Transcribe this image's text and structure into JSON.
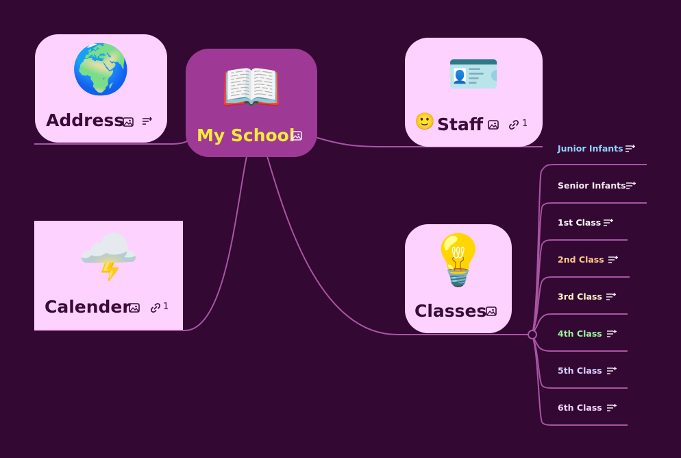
{
  "central": {
    "title": "My School",
    "emoji": "📖"
  },
  "nodes": {
    "address": {
      "title": "Address",
      "emoji": "🌍"
    },
    "staff": {
      "title": "Staff",
      "emoji": "🪪",
      "prefix_emoji": "🙂",
      "link_count": "1"
    },
    "calender": {
      "title": "Calender",
      "emoji": "🌩️",
      "link_count": "1"
    },
    "classes": {
      "title": "Classes",
      "emoji": "💡"
    }
  },
  "class_list": [
    {
      "label": "Junior Infants",
      "color": "#8fd6ff"
    },
    {
      "label": "Senior Infants",
      "color": "#f4e6f4"
    },
    {
      "label": "1st Class",
      "color": "#ffffff"
    },
    {
      "label": "2nd Class",
      "color": "#ffc98a"
    },
    {
      "label": "3rd Class",
      "color": "#fff3c4"
    },
    {
      "label": "4th Class",
      "color": "#9af59a"
    },
    {
      "label": "5th Class",
      "color": "#d7d0ff"
    },
    {
      "label": "6th Class",
      "color": "#f1d6ff"
    }
  ],
  "colors": {
    "background": "#330833",
    "node": "#fdd2ff",
    "central": "#9e3a96",
    "central_text": "#f6ea3a",
    "link": "#a855a3"
  }
}
